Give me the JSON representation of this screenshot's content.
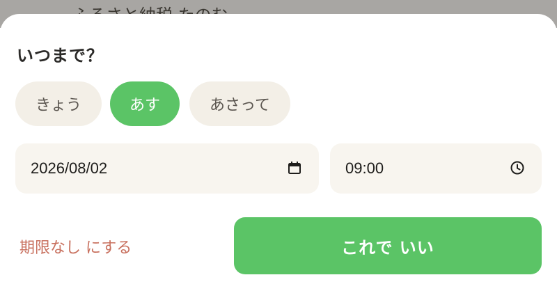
{
  "backdrop": {
    "text": "ふるさと納税 たのむ"
  },
  "sheet": {
    "title": "いつまで？",
    "chips": [
      {
        "label": "きょう",
        "selected": false
      },
      {
        "label": "あす",
        "selected": true
      },
      {
        "label": "あさって",
        "selected": false
      }
    ],
    "date_input": {
      "value": "2026/08/02",
      "icon": "calendar-icon"
    },
    "time_input": {
      "value": "09:00",
      "icon": "clock-icon"
    },
    "clear_label": "期限なし にする",
    "confirm_label": "これで いい"
  },
  "colors": {
    "accent": "#5bc466",
    "chip_bg": "#f3efe7",
    "field_bg": "#f8f5ef",
    "link": "#c8705e"
  }
}
